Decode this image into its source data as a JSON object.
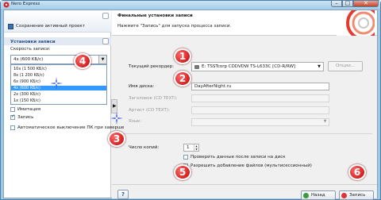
{
  "window": {
    "title": "Nero Express"
  },
  "left_panel": {
    "save_project_label": "Сохранение активный проект",
    "section_title": "Установки записи",
    "speed_label": "Скорость записи:",
    "speed_selected": "4x (600 KБ/с)",
    "speed_options": [
      "10x (1 500 KБ/с)",
      "8x (1 200 KБ/с)",
      "6x (900 KБ/с)",
      "4x (600 KБ/с)",
      "2x (300 KБ/с)",
      "1x (150 KБ/с)"
    ],
    "speed_selected_index": 3,
    "imitation_label": "Имитация",
    "imitation_checked": false,
    "record_label": "Запись",
    "record_checked": true,
    "auto_shutdown_label": "Автоматическое выключение ПК при заверше"
  },
  "header": {
    "title": "Финальные установки записи",
    "subtitle": "Нажмите \"Запись\" для запуска процесса записи."
  },
  "form": {
    "recorder_label": "Текущий рекордер:",
    "recorder_value": "E: TSSTcorp CDDVDW TS-L633C   [CD-R/RW]",
    "options_button": "Опции...",
    "disc_name_label": "Имя диска:",
    "disc_name_value": "DayAfterNight.ru",
    "title_label": "Заголовок (CD TEXT):",
    "artist_label": "Артист (CD TEXT):",
    "language_label": "Язык:",
    "copies_label": "Число копий:",
    "copies_value": "1",
    "verify_label": "Проверить данные после записи на диск",
    "multisession_label": "Разрешить добавление файлов (мультисессионный)",
    "verify_checked": false,
    "multisession_checked": false
  },
  "footer": {
    "help_icon": "?",
    "back_label": "Назад",
    "burn_label": "Запись"
  },
  "markers": [
    "1",
    "2",
    "3",
    "4",
    "5",
    "6"
  ],
  "colors": {
    "marker": "#c40000",
    "selection": "#3399ff",
    "section_title": "#2a4f85"
  }
}
